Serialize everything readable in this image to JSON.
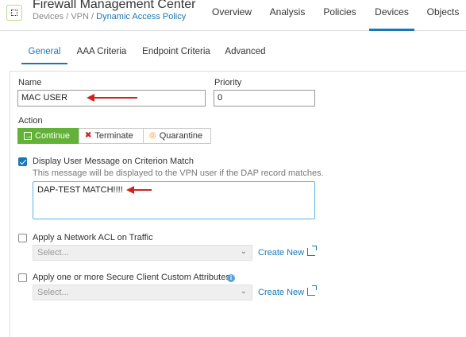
{
  "header": {
    "app_title": "Firewall Management Center",
    "breadcrumb": [
      "Devices",
      "VPN",
      "Dynamic Access Policy"
    ],
    "nav": [
      "Overview",
      "Analysis",
      "Policies",
      "Devices",
      "Objects"
    ],
    "selected_nav": "Devices"
  },
  "tabs": [
    "General",
    "AAA Criteria",
    "Endpoint Criteria",
    "Advanced"
  ],
  "selected_tab": "General",
  "form": {
    "name_label": "Name",
    "name_value": "MAC USER",
    "priority_label": "Priority",
    "priority_value": "0",
    "action_label": "Action",
    "actions": [
      "Continue",
      "Terminate",
      "Quarantine"
    ],
    "selected_action": "Continue",
    "display_message": {
      "label": "Display User Message on Criterion Match",
      "checked": true,
      "hint": "This message will be displayed to the VPN user if the DAP record matches.",
      "message": "DAP-TEST MATCH!!!!"
    },
    "network_acl": {
      "label": "Apply a Network ACL on Traffic",
      "checked": false,
      "select_placeholder": "Select...",
      "create_new": "Create New"
    },
    "custom_attributes": {
      "label": "Apply one or more Secure Client Custom Attributes",
      "checked": false,
      "select_placeholder": "Select...",
      "create_new": "Create New"
    }
  },
  "colors": {
    "accent": "#1a77b5",
    "continue_green": "#62b238",
    "annotation_arrow": "#d0231b"
  }
}
